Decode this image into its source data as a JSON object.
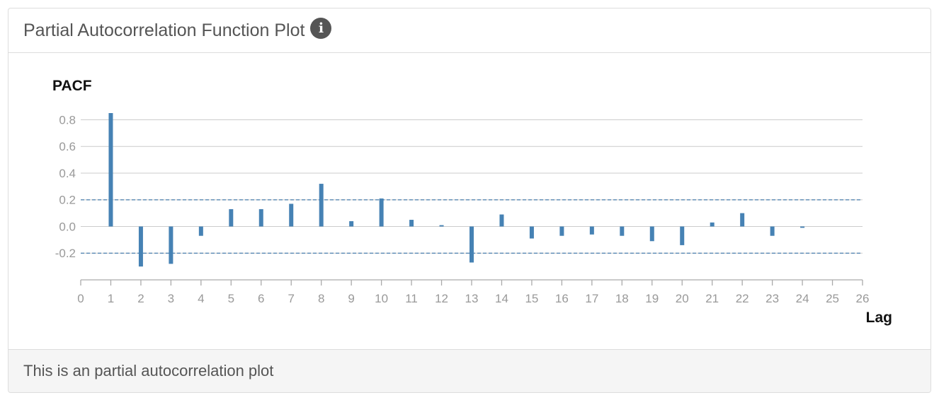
{
  "panel": {
    "title": "Partial Autocorrelation Function Plot",
    "info_icon": "info-circle-icon",
    "footer_text": "This is an partial autocorrelation plot"
  },
  "colors": {
    "bar": "#4682b4",
    "grid": "#cccccc",
    "axis": "#aaaaaa",
    "tick_label": "#999999",
    "confidence": "#4a7fb0"
  },
  "chart_data": {
    "type": "bar",
    "ylabel": "PACF",
    "xlabel": "Lag",
    "x": [
      1,
      2,
      3,
      4,
      5,
      6,
      7,
      8,
      9,
      10,
      11,
      12,
      13,
      14,
      15,
      16,
      17,
      18,
      19,
      20,
      21,
      22,
      23,
      24
    ],
    "values": [
      0.85,
      -0.3,
      -0.28,
      -0.07,
      0.13,
      0.13,
      0.17,
      0.32,
      0.04,
      0.21,
      0.05,
      0.01,
      -0.27,
      0.09,
      -0.09,
      -0.07,
      -0.06,
      -0.07,
      -0.11,
      -0.14,
      0.03,
      0.1,
      -0.07,
      -0.01
    ],
    "xlim": [
      0,
      26
    ],
    "ylim": [
      -0.4,
      0.9
    ],
    "yticks": [
      "0.8",
      "0.6",
      "0.4",
      "0.2",
      "0.0",
      "-0.2"
    ],
    "xticks": [
      "0",
      "1",
      "2",
      "3",
      "4",
      "5",
      "6",
      "7",
      "8",
      "9",
      "10",
      "11",
      "12",
      "13",
      "14",
      "15",
      "16",
      "17",
      "18",
      "19",
      "20",
      "21",
      "22",
      "23",
      "24",
      "25",
      "26"
    ],
    "confidence_bounds": [
      0.2,
      -0.2
    ],
    "grid": true
  }
}
